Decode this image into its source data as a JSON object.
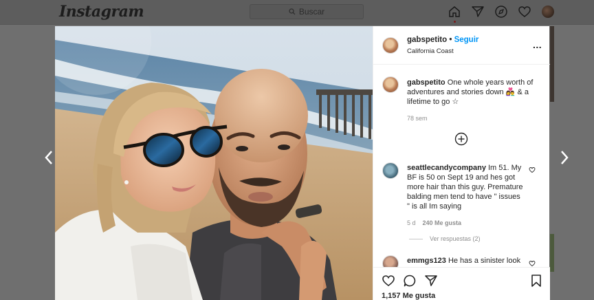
{
  "nav": {
    "logo": "Instagram",
    "search_placeholder": "Buscar"
  },
  "post": {
    "username": "gabspetito",
    "separator": "•",
    "follow_label": "Seguir",
    "location": "California Coast",
    "more_label": "...",
    "caption_text": "One whole years worth of adventures and stories down 👩‍❤️‍👨 & a lifetime to go ☆",
    "caption_age": "78 sem",
    "likes": "1,157 Me gusta"
  },
  "comments": [
    {
      "username": "seattlecandycompany",
      "text": "Im 51. My BF is 50 on Sept 19 and hes got more hair than this guy. Premature balding men tend to have \" issues \" is all Im saying",
      "age": "5 d",
      "likes": "240 Me gusta",
      "replies_label": "Ver respuestas (2)"
    },
    {
      "username": "emmgs123",
      "text": "He has a sinister look"
    }
  ],
  "icons": {
    "home": "home-icon",
    "direct": "paper-plane-icon",
    "explore": "compass-icon",
    "activity": "heart-icon",
    "like": "heart-icon",
    "comment": "comment-icon",
    "share": "paper-plane-icon",
    "save": "bookmark-icon",
    "add_comment": "plus-circle-icon"
  },
  "colors": {
    "accent": "#0095f6",
    "overlay": "#6f6f6f"
  }
}
